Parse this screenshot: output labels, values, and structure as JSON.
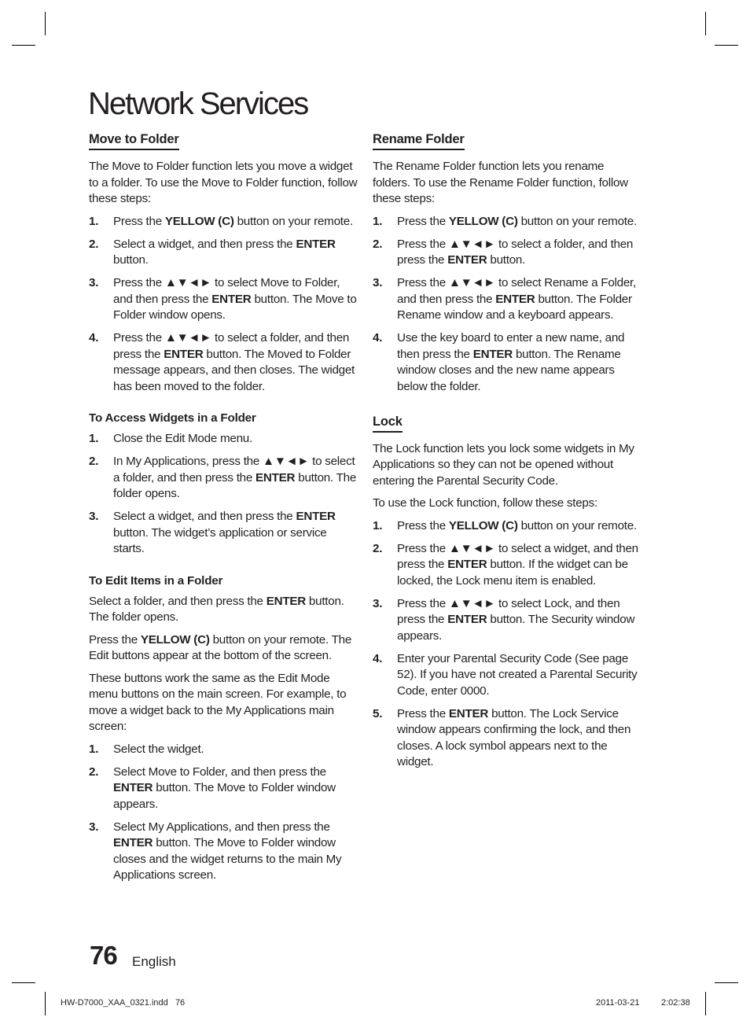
{
  "page_title": "Network Services",
  "arrows": "▲▼◄►",
  "left_column": {
    "move_to_folder": {
      "heading": "Move to Folder",
      "intro": "The Move to Folder function lets you move a widget to a folder. To use the Move to Folder function, follow these steps:",
      "steps": [
        {
          "num": "1.",
          "parts": [
            [
              "Press the ",
              false
            ],
            [
              "YELLOW (C)",
              true
            ],
            [
              " button on your remote.",
              false
            ]
          ]
        },
        {
          "num": "2.",
          "parts": [
            [
              "Select a widget, and then press the ",
              false
            ],
            [
              "ENTER",
              true
            ],
            [
              " button.",
              false
            ]
          ]
        },
        {
          "num": "3.",
          "parts": [
            [
              "Press the ▲▼◄► to select Move to Folder, and then press the ",
              false
            ],
            [
              "ENTER",
              true
            ],
            [
              " button. The Move to Folder window opens.",
              false
            ]
          ]
        },
        {
          "num": "4.",
          "parts": [
            [
              "Press the ▲▼◄► to select a folder, and then press the ",
              false
            ],
            [
              "ENTER",
              true
            ],
            [
              " button. The Moved to Folder message appears, and then closes. The widget has been moved to the folder.",
              false
            ]
          ]
        }
      ]
    },
    "access_widgets": {
      "heading": "To Access Widgets in a Folder",
      "steps": [
        {
          "num": "1.",
          "parts": [
            [
              "Close the Edit Mode menu.",
              false
            ]
          ]
        },
        {
          "num": "2.",
          "parts": [
            [
              "In My Applications, press the ▲▼◄► to select a folder, and then press the ",
              false
            ],
            [
              "ENTER",
              true
            ],
            [
              " button. The folder opens.",
              false
            ]
          ]
        },
        {
          "num": "3.",
          "parts": [
            [
              "Select a widget, and then press the ",
              false
            ],
            [
              "ENTER",
              true
            ],
            [
              " button. The widget’s application or service starts.",
              false
            ]
          ]
        }
      ]
    },
    "edit_items": {
      "heading": "To Edit Items in a Folder",
      "paragraphs": [
        [
          [
            "Select a folder, and then press the ",
            false
          ],
          [
            "ENTER",
            true
          ],
          [
            " button. The folder opens.",
            false
          ]
        ],
        [
          [
            "Press the ",
            false
          ],
          [
            "YELLOW (C)",
            true
          ],
          [
            " button on your remote. The Edit buttons appear at the bottom of the screen.",
            false
          ]
        ],
        [
          [
            "These buttons work the same as the Edit Mode menu buttons on the main screen. For example, to move a widget back to the My Applications main screen:",
            false
          ]
        ]
      ],
      "steps": [
        {
          "num": "1.",
          "parts": [
            [
              "Select the widget.",
              false
            ]
          ]
        },
        {
          "num": "2.",
          "parts": [
            [
              "Select Move to Folder, and then press the ",
              false
            ],
            [
              "ENTER",
              true
            ],
            [
              " button. The Move to Folder window appears.",
              false
            ]
          ]
        },
        {
          "num": "3.",
          "parts": [
            [
              "Select My Applications, and then press the ",
              false
            ],
            [
              "ENTER",
              true
            ],
            [
              " button. The Move to Folder window closes and the widget returns to the main My Applications screen.",
              false
            ]
          ]
        }
      ]
    }
  },
  "right_column": {
    "rename_folder": {
      "heading": "Rename Folder",
      "intro": "The Rename Folder function lets you rename folders. To use the Rename Folder function, follow these steps:",
      "steps": [
        {
          "num": "1.",
          "parts": [
            [
              "Press the ",
              false
            ],
            [
              "YELLOW (C)",
              true
            ],
            [
              " button on your remote.",
              false
            ]
          ]
        },
        {
          "num": "2.",
          "parts": [
            [
              "Press the ▲▼◄► to select a folder, and then press the ",
              false
            ],
            [
              "ENTER",
              true
            ],
            [
              " button.",
              false
            ]
          ]
        },
        {
          "num": "3.",
          "parts": [
            [
              "Press the ▲▼◄► to select Rename a Folder, and then press the ",
              false
            ],
            [
              "ENTER",
              true
            ],
            [
              " button. The Folder Rename window and a keyboard appears.",
              false
            ]
          ]
        },
        {
          "num": "4.",
          "parts": [
            [
              "Use the key board to enter a new name, and then press the ",
              false
            ],
            [
              "ENTER",
              true
            ],
            [
              " button. The Rename window closes and the new name appears below the folder.",
              false
            ]
          ]
        }
      ]
    },
    "lock": {
      "heading": "Lock",
      "intro": "The Lock function lets you lock some widgets in My Applications so they can not be opened without entering the Parental Security Code.",
      "intro2": "To use the Lock function, follow these steps:",
      "steps": [
        {
          "num": "1.",
          "parts": [
            [
              "Press the ",
              false
            ],
            [
              "YELLOW (C)",
              true
            ],
            [
              " button on your remote.",
              false
            ]
          ]
        },
        {
          "num": "2.",
          "parts": [
            [
              "Press the ▲▼◄► to select a widget, and then press the ",
              false
            ],
            [
              "ENTER",
              true
            ],
            [
              " button. If the widget can be locked, the Lock menu item is enabled.",
              false
            ]
          ]
        },
        {
          "num": "3.",
          "parts": [
            [
              "Press the ▲▼◄► to select Lock, and then press the ",
              false
            ],
            [
              "ENTER",
              true
            ],
            [
              " button. The Security window appears.",
              false
            ]
          ]
        },
        {
          "num": "4.",
          "parts": [
            [
              "Enter your Parental Security Code (See page 52). If you have not created a Parental Security Code, enter 0000.",
              false
            ]
          ]
        },
        {
          "num": "5.",
          "parts": [
            [
              "Press the ",
              false
            ],
            [
              "ENTER",
              true
            ],
            [
              " button. The Lock Service window appears confirming the lock, and then closes. A lock symbol appears next to the widget.",
              false
            ]
          ]
        }
      ]
    }
  },
  "footer": {
    "page_number": "76",
    "language": "English",
    "slug_file": "HW-D7000_XAA_0321.indd   76",
    "slug_date": "2011-03-21",
    "slug_time": "2:02:38"
  }
}
